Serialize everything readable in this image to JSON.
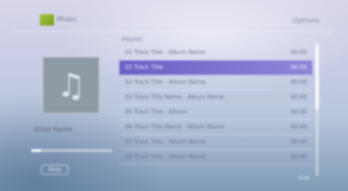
{
  "header": {
    "app_title": "Music",
    "right_label": "Options"
  },
  "now_playing": {
    "art_icon": "music-note-icon",
    "album_name": "Artist Name",
    "progress_fraction": 0.12,
    "stop_label": "Stop"
  },
  "playlist": {
    "caption": "Playlist",
    "selected_index": 1,
    "items": [
      {
        "title": "01 Track Title - Album Name",
        "duration": "00:00"
      },
      {
        "title": "02 Track Title",
        "duration": "00:00"
      },
      {
        "title": "03 Track Title - Album Name",
        "duration": "00:00"
      },
      {
        "title": "04 Track Title Name - Album Name",
        "duration": "00:00"
      },
      {
        "title": "05 Track Title - Album",
        "duration": "00:00"
      },
      {
        "title": "06 Track Title Name - Album Name",
        "duration": "00:00"
      },
      {
        "title": "07 Track Title - Album Name",
        "duration": "00:00"
      },
      {
        "title": "08 Track Title - Album Name",
        "duration": "00:00"
      }
    ]
  },
  "footer": {
    "hint": "Exit"
  }
}
